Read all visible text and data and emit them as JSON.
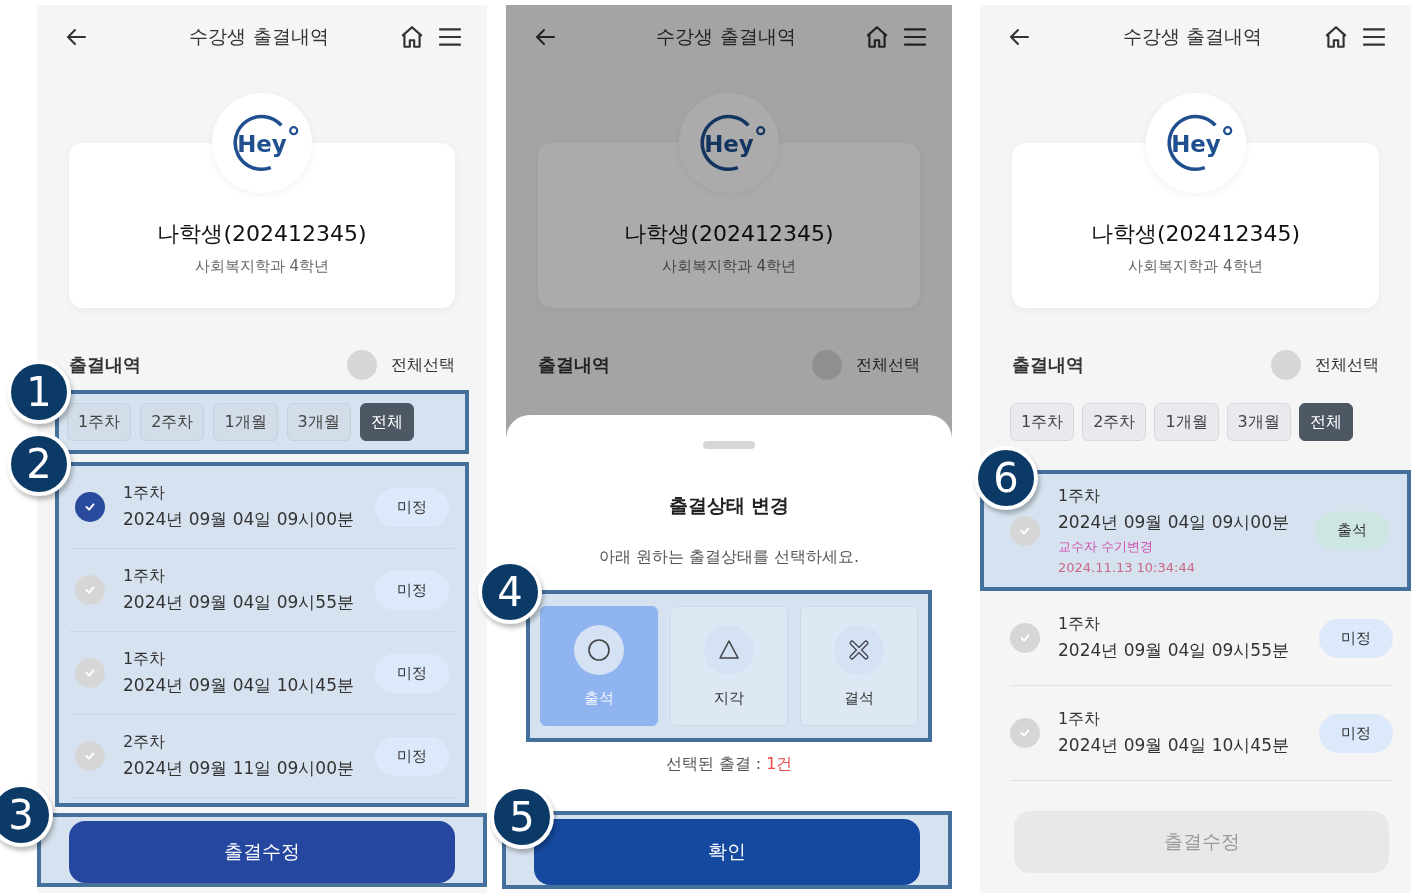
{
  "screens": [
    {
      "kind": "list",
      "header": {
        "title": "수강생 출결내역"
      },
      "profile": {
        "logo": "Hey",
        "name": "나학생(202412345)",
        "department": "사회복지학과 4학년"
      },
      "section_title": "출결내역",
      "select_all": {
        "label": "전체선택",
        "checked": false
      },
      "filters": {
        "callout": "1",
        "items": [
          {
            "label": "1주차",
            "selected": false
          },
          {
            "label": "2주차",
            "selected": false
          },
          {
            "label": "1개월",
            "selected": false
          },
          {
            "label": "3개월",
            "selected": false
          },
          {
            "label": "전체",
            "selected": true
          }
        ]
      },
      "records": {
        "callout": "2",
        "items": [
          {
            "week": "1주차",
            "datetime": "2024년 09월 04일 09시00분",
            "status": "미정",
            "kind": "pending",
            "checked": true
          },
          {
            "week": "1주차",
            "datetime": "2024년 09월 04일 09시55분",
            "status": "미정",
            "kind": "pending",
            "checked": false
          },
          {
            "week": "1주차",
            "datetime": "2024년 09월 04일 10시45분",
            "status": "미정",
            "kind": "pending",
            "checked": false
          },
          {
            "week": "2주차",
            "datetime": "2024년 09월 11일 09시00분",
            "status": "미정",
            "kind": "pending",
            "checked": false
          }
        ]
      },
      "action": {
        "label": "출결수정",
        "disabled": false,
        "callout": "3"
      }
    },
    {
      "kind": "sheet",
      "header": {
        "title": "수강생 출결내역"
      },
      "profile": {
        "logo": "Hey",
        "name": "나학생(202412345)",
        "department": "사회복지학과 4학년"
      },
      "section_title": "출결내역",
      "select_all": {
        "label": "전체선택",
        "checked": false
      },
      "sheet": {
        "title": "출결상태 변경",
        "instruction": "아래 원하는 출결상태를 선택하세요.",
        "callout": "4",
        "options": [
          {
            "label": "출석",
            "kind": "circle",
            "selected": true
          },
          {
            "label": "지각",
            "kind": "triangle",
            "selected": false
          },
          {
            "label": "결석",
            "kind": "cross",
            "selected": false
          }
        ],
        "summary_label": "선택된 출결 : ",
        "summary_count": "1건",
        "confirm": {
          "label": "확인",
          "callout": "5"
        }
      }
    },
    {
      "kind": "list",
      "header": {
        "title": "수강생 출결내역"
      },
      "profile": {
        "logo": "Hey",
        "name": "나학생(202412345)",
        "department": "사회복지학과 4학년"
      },
      "section_title": "출결내역",
      "select_all": {
        "label": "전체선택",
        "checked": false
      },
      "filters": {
        "items": [
          {
            "label": "1주차",
            "selected": false
          },
          {
            "label": "2주차",
            "selected": false
          },
          {
            "label": "1개월",
            "selected": false
          },
          {
            "label": "3개월",
            "selected": false
          },
          {
            "label": "전체",
            "selected": true
          }
        ]
      },
      "records": {
        "items": [
          {
            "week": "1주차",
            "datetime": "2024년 09월 04일 09시00분",
            "note": "교수자 수기변경",
            "note_time": "2024.11.13 10:34:44",
            "status": "출석",
            "kind": "present",
            "checked": false,
            "callout": "6"
          },
          {
            "week": "1주차",
            "datetime": "2024년 09월 04일 09시55분",
            "status": "미정",
            "kind": "pending",
            "checked": false
          },
          {
            "week": "1주차",
            "datetime": "2024년 09월 04일 10시45분",
            "status": "미정",
            "kind": "pending",
            "checked": false
          }
        ]
      },
      "action": {
        "label": "출결수정",
        "disabled": true
      }
    }
  ]
}
